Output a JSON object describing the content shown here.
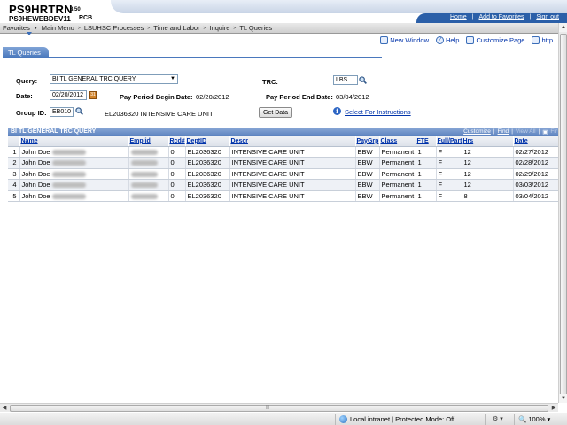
{
  "header": {
    "system": "PS9HRTRN",
    "version": "8.50",
    "database": "PS9HEWEBDEV11",
    "user": "RCB",
    "links": [
      "Home",
      "Add to Favorites",
      "Sign out"
    ]
  },
  "menu": {
    "items": [
      "Favorites",
      "Main Menu",
      "LSUHSC Processes",
      "Time and Labor",
      "Inquire",
      "TL Queries"
    ]
  },
  "page_tools": {
    "new_window": "New Window",
    "help": "Help",
    "customize": "Customize Page",
    "http": "http"
  },
  "tab": {
    "label": "TL Queries"
  },
  "form": {
    "query_label": "Query:",
    "query_value": "BI TL GENERAL TRC QUERY",
    "trc_label": "TRC:",
    "trc_value": "LBS",
    "date_label": "Date:",
    "date_value": "02/20/2012",
    "begin_label": "Pay Period Begin Date:",
    "begin_value": "02/20/2012",
    "end_label": "Pay Period End Date:",
    "end_value": "03/04/2012",
    "group_label": "Group ID:",
    "group_value": "EB010",
    "group_desc": "EL2036320 INTENSIVE CARE UNIT",
    "get_data": "Get Data",
    "instructions": "Select For Instructions"
  },
  "grid": {
    "title": "BI TL GENERAL TRC QUERY",
    "nav": {
      "customize": "Customize",
      "find": "Find",
      "view_all": "View All",
      "first": "Fir"
    },
    "columns": [
      "Name",
      "Emplid",
      "Rcd#",
      "DeptID",
      "Descr",
      "PayGrp",
      "Class",
      "FTE",
      "Full/Part",
      "Hrs",
      "Date"
    ],
    "rows": [
      {
        "n": "1",
        "name": "John Doe",
        "rcd": "0",
        "dept": "EL2036320",
        "descr": "INTENSIVE CARE UNIT",
        "paygrp": "EBW",
        "class": "Permanent",
        "fte": "1",
        "fp": "F",
        "hrs": "12",
        "date": "02/27/2012"
      },
      {
        "n": "2",
        "name": "John Doe",
        "rcd": "0",
        "dept": "EL2036320",
        "descr": "INTENSIVE CARE UNIT",
        "paygrp": "EBW",
        "class": "Permanent",
        "fte": "1",
        "fp": "F",
        "hrs": "12",
        "date": "02/28/2012"
      },
      {
        "n": "3",
        "name": "John Doe",
        "rcd": "0",
        "dept": "EL2036320",
        "descr": "INTENSIVE CARE UNIT",
        "paygrp": "EBW",
        "class": "Permanent",
        "fte": "1",
        "fp": "F",
        "hrs": "12",
        "date": "02/29/2012"
      },
      {
        "n": "4",
        "name": "John Doe",
        "rcd": "0",
        "dept": "EL2036320",
        "descr": "INTENSIVE CARE UNIT",
        "paygrp": "EBW",
        "class": "Permanent",
        "fte": "1",
        "fp": "F",
        "hrs": "12",
        "date": "03/03/2012"
      },
      {
        "n": "5",
        "name": "John Doe",
        "rcd": "0",
        "dept": "EL2036320",
        "descr": "INTENSIVE CARE UNIT",
        "paygrp": "EBW",
        "class": "Permanent",
        "fte": "1",
        "fp": "F",
        "hrs": "8",
        "date": "03/04/2012"
      }
    ]
  },
  "statusbar": {
    "zone": "Local intranet | Protected Mode: Off",
    "zoom": "100%"
  }
}
